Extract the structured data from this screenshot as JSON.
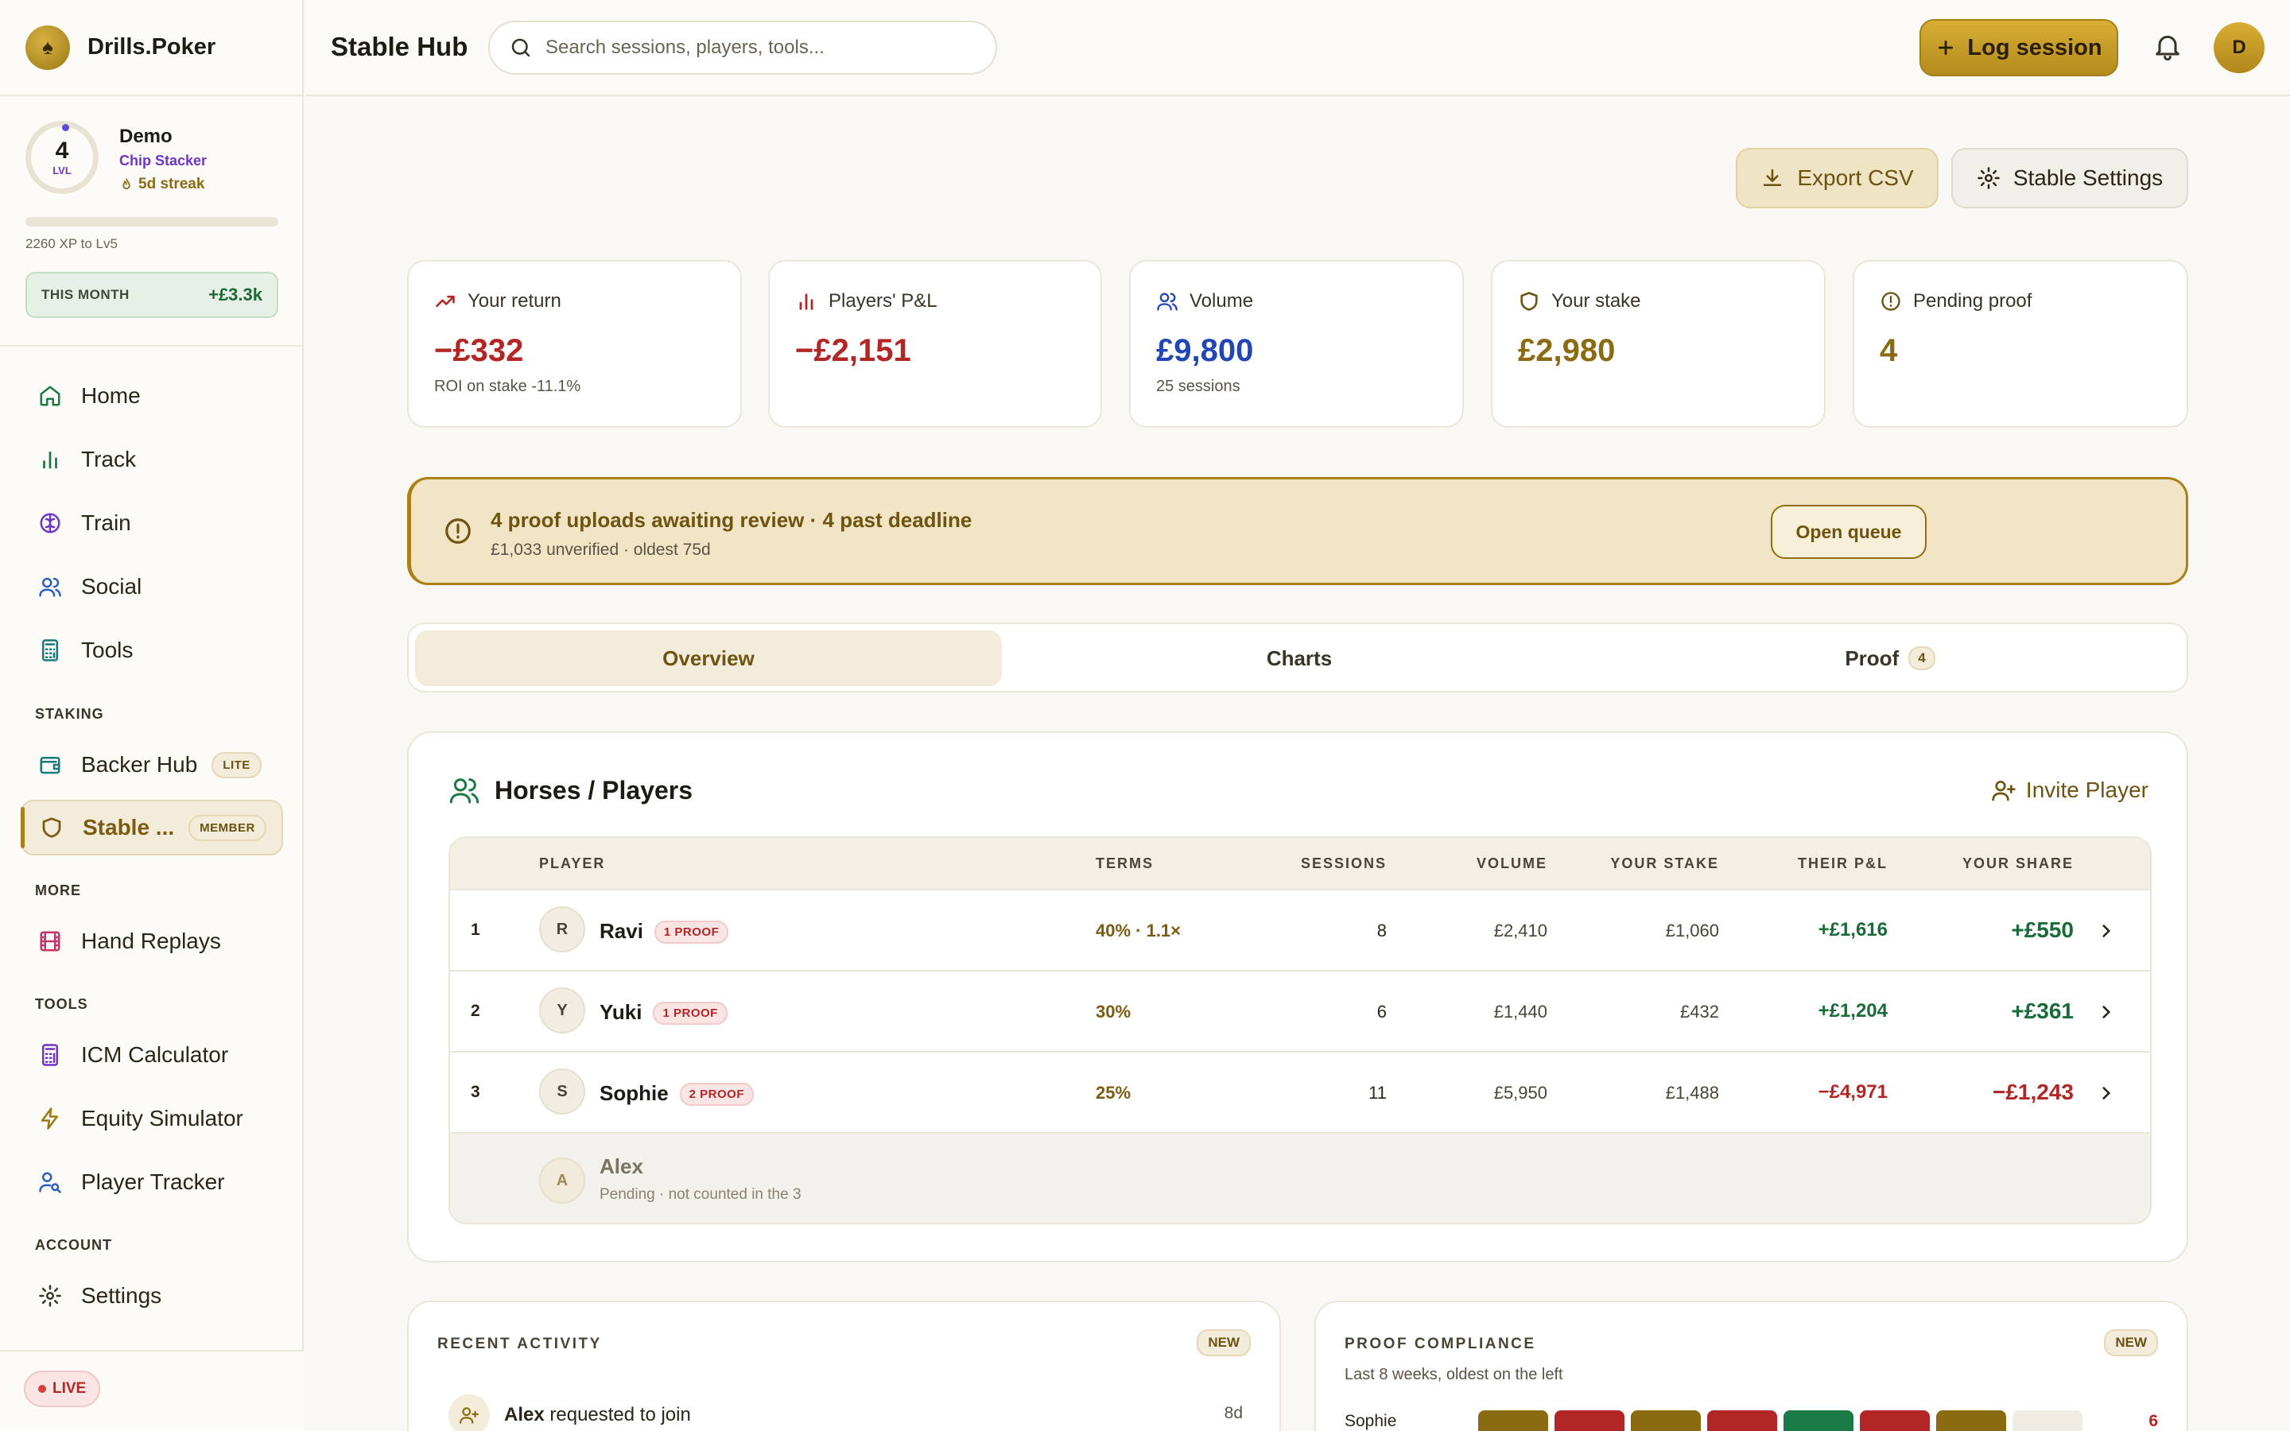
{
  "brand": {
    "name": "Drills.Poker",
    "logo_icon": "spade-icon"
  },
  "profile": {
    "level": "4",
    "level_label": "LVL",
    "name": "Demo",
    "title": "Chip Stacker",
    "streak": "5d streak",
    "xp_text": "2260 XP to Lv5",
    "xp_progress": 0.0
  },
  "this_month": {
    "label": "THIS MONTH",
    "value": "+£3.3k"
  },
  "nav": {
    "main": [
      {
        "label": "Home",
        "icon": "home-icon"
      },
      {
        "label": "Track",
        "icon": "bar-chart-icon"
      },
      {
        "label": "Train",
        "icon": "brain-icon"
      },
      {
        "label": "Social",
        "icon": "users-icon"
      },
      {
        "label": "Tools",
        "icon": "calculator-icon"
      }
    ],
    "staking_label": "STAKING",
    "staking": [
      {
        "label": "Backer Hub",
        "badge": "LITE",
        "icon": "wallet-icon"
      },
      {
        "label": "Stable ...",
        "badge": "MEMBER",
        "icon": "shield-icon",
        "active": true
      }
    ],
    "more_label": "MORE",
    "more": [
      {
        "label": "Hand Replays",
        "icon": "film-icon"
      }
    ],
    "tools_label": "TOOLS",
    "tools": [
      {
        "label": "ICM Calculator",
        "icon": "calculator-icon"
      },
      {
        "label": "Equity Simulator",
        "icon": "zap-icon"
      },
      {
        "label": "Player Tracker",
        "icon": "user-search-icon"
      }
    ],
    "account_label": "ACCOUNT",
    "account": [
      {
        "label": "Settings",
        "icon": "gear-icon"
      }
    ]
  },
  "live_label": "LIVE",
  "header": {
    "title": "Stable Hub",
    "search_placeholder": "Search sessions, players, tools...",
    "log_button": "Log session",
    "avatar_initial": "D"
  },
  "actions": {
    "export": "Export CSV",
    "settings": "Stable Settings"
  },
  "colors": {
    "accent": "#b48b1d",
    "positive": "#1a6b3a",
    "negative": "#b22626",
    "volume": "#2246b4"
  },
  "stats": [
    {
      "label": "Your return",
      "value": "−£332",
      "sub": "ROI on stake -11.1%",
      "icon": "trending-icon"
    },
    {
      "label": "Players' P&L",
      "value": "−£2,151",
      "sub": "",
      "icon": "bar-chart-icon"
    },
    {
      "label": "Volume",
      "value": "£9,800",
      "sub": "25 sessions",
      "icon": "users-icon"
    },
    {
      "label": "Your stake",
      "value": "£2,980",
      "sub": "",
      "icon": "shield-icon"
    },
    {
      "label": "Pending proof",
      "value": "4",
      "sub": "",
      "icon": "alert-circle-icon"
    }
  ],
  "alert": {
    "title": "4 proof uploads awaiting review · 4 past deadline",
    "sub": "£1,033 unverified · oldest 75d",
    "button": "Open queue"
  },
  "tabs": [
    {
      "label": "Overview"
    },
    {
      "label": "Charts"
    },
    {
      "label": "Proof",
      "badge": "4"
    }
  ],
  "players_panel": {
    "title": "Horses / Players",
    "invite": "Invite Player",
    "columns": [
      "PLAYER",
      "TERMS",
      "SESSIONS",
      "VOLUME",
      "YOUR STAKE",
      "THEIR P&L",
      "YOUR SHARE"
    ],
    "rows": [
      {
        "num": "1",
        "initial": "R",
        "name": "Ravi",
        "badge": "1 PROOF",
        "terms": "40% · 1.1×",
        "sessions": "8",
        "volume": "£2,410",
        "stake": "£1,060",
        "their_pnl": "+£1,616",
        "share": "+£550"
      },
      {
        "num": "2",
        "initial": "Y",
        "name": "Yuki",
        "badge": "1 PROOF",
        "terms": "30%",
        "sessions": "6",
        "volume": "£1,440",
        "stake": "£432",
        "their_pnl": "+£1,204",
        "share": "+£361"
      },
      {
        "num": "3",
        "initial": "S",
        "name": "Sophie",
        "badge": "2 PROOF",
        "terms": "25%",
        "sessions": "11",
        "volume": "£5,950",
        "stake": "£1,488",
        "their_pnl": "−£4,971",
        "share": "−£1,243"
      }
    ],
    "pending": {
      "initial": "A",
      "name": "Alex",
      "sub": "Pending · not counted in the 3"
    }
  },
  "recent_activity": {
    "title": "RECENT ACTIVITY",
    "badge": "NEW",
    "item_name": "Alex",
    "item_text": "requested to join",
    "item_time": "8d"
  },
  "proof_compliance": {
    "title": "PROOF COMPLIANCE",
    "badge": "NEW",
    "sub": "Last 8 weeks, oldest on the left",
    "row_name": "Sophie",
    "row_count": "6",
    "cells": [
      "#8b6b12",
      "#b22626",
      "#8b6b12",
      "#b22626",
      "#1a7a45",
      "#b22626",
      "#8b6b12",
      "#efece4"
    ]
  }
}
